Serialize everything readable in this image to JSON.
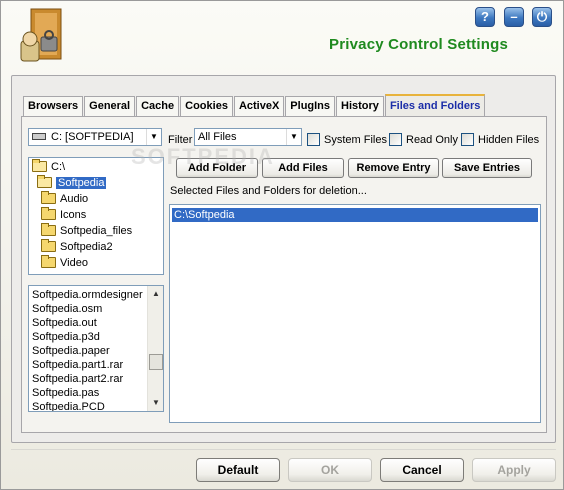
{
  "header": {
    "title": "Privacy Control Settings",
    "help_label": "?",
    "minimize_label": "–",
    "close_label": "⏻"
  },
  "tabs": [
    {
      "label": "Browsers"
    },
    {
      "label": "General"
    },
    {
      "label": "Cache"
    },
    {
      "label": "Cookies"
    },
    {
      "label": "ActiveX"
    },
    {
      "label": "PlugIns"
    },
    {
      "label": "History"
    },
    {
      "label": "Files and Folders",
      "active": true
    }
  ],
  "drive_select": {
    "value": "C: [SOFTPEDIA]"
  },
  "filter": {
    "label": "Filter",
    "value": "All Files",
    "system_files_label": "System Files",
    "read_only_label": "Read Only",
    "hidden_files_label": "Hidden Files"
  },
  "folder_tree": [
    {
      "label": "C:\\",
      "level": 0,
      "open": true
    },
    {
      "label": "Softpedia",
      "level": 1,
      "open": true,
      "selected": true
    },
    {
      "label": "Audio",
      "level": 2
    },
    {
      "label": "Icons",
      "level": 2
    },
    {
      "label": "Softpedia_files",
      "level": 2
    },
    {
      "label": "Softpedia2",
      "level": 2
    },
    {
      "label": "Video",
      "level": 2
    }
  ],
  "file_list": [
    "Softpedia.ormdesigner",
    "Softpedia.osm",
    "Softpedia.out",
    "Softpedia.p3d",
    "Softpedia.paper",
    "Softpedia.part1.rar",
    "Softpedia.part2.rar",
    "Softpedia.pas",
    "Softpedia.PCD"
  ],
  "actions": {
    "add_folder": "Add Folder",
    "add_files": "Add Files",
    "remove_entry": "Remove Entry",
    "save_entries": "Save Entries"
  },
  "selection_label": "Selected Files and Folders for deletion...",
  "selected_entries": [
    {
      "path": "C:\\Softpedia",
      "selected": true
    }
  ],
  "watermark": "SOFTPEDIA",
  "footer": {
    "default_label": "Default",
    "ok_label": "OK",
    "cancel_label": "Cancel",
    "apply_label": "Apply"
  },
  "colors": {
    "title_green": "#1f8a1f",
    "active_tab_text": "#1c2ea8",
    "selection_blue": "#316ac5"
  }
}
